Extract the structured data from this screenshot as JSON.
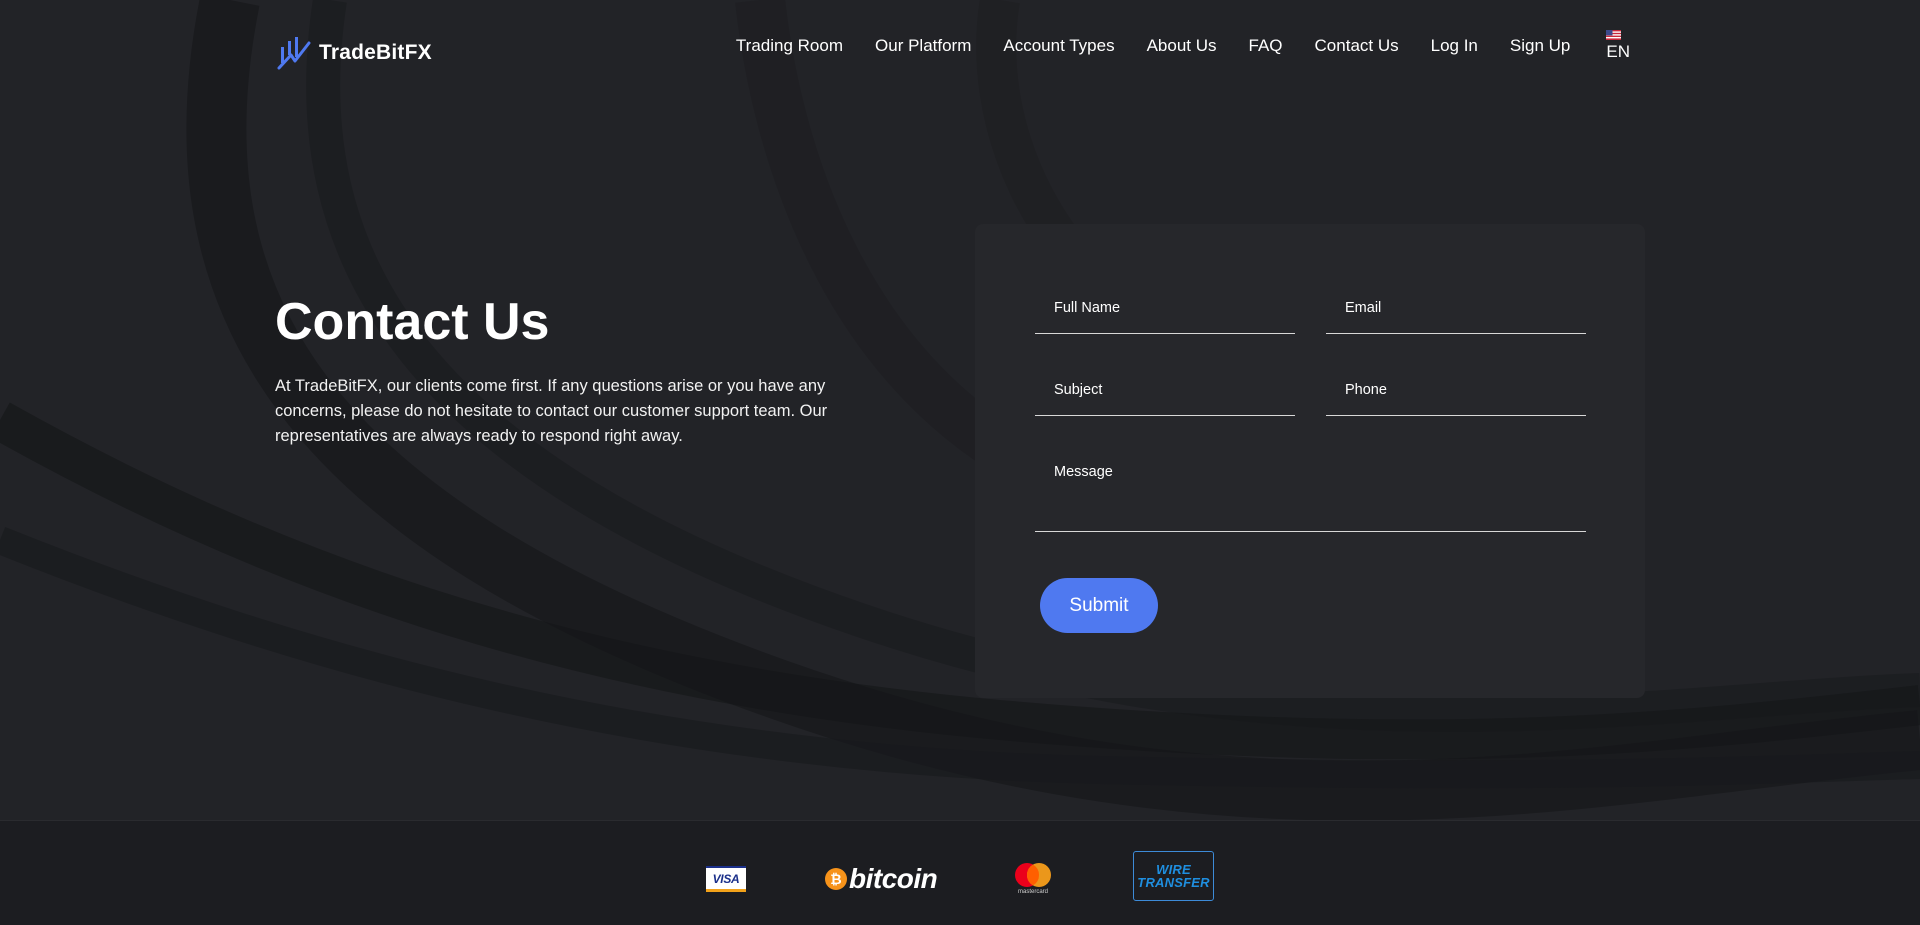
{
  "brand": {
    "name": "TradeBitFX",
    "accent": "#4f79f0",
    "logo_icon": "chart-logo-icon"
  },
  "nav": {
    "items": [
      {
        "label": "Trading Room"
      },
      {
        "label": "Our Platform"
      },
      {
        "label": "Account Types"
      },
      {
        "label": "About Us"
      },
      {
        "label": "FAQ"
      },
      {
        "label": "Contact Us"
      },
      {
        "label": "Log In"
      },
      {
        "label": "Sign Up"
      }
    ],
    "language": {
      "label": "EN",
      "icon": "us-flag-icon"
    }
  },
  "hero": {
    "title": "Contact Us",
    "description": "At TradeBitFX, our clients come first. If any questions arise or you have any concerns, please do not hesitate to contact our customer support team. Our representatives are always ready to respond right away."
  },
  "form": {
    "full_name_placeholder": "Full Name",
    "email_placeholder": "Email",
    "subject_placeholder": "Subject",
    "phone_placeholder": "Phone",
    "message_placeholder": "Message",
    "submit_label": "Submit"
  },
  "payments": {
    "visa": "VISA",
    "bitcoin": "bitcoin",
    "mastercard": "mastercard",
    "wire_line1": "WIRE",
    "wire_line2": "TRANSFER"
  }
}
